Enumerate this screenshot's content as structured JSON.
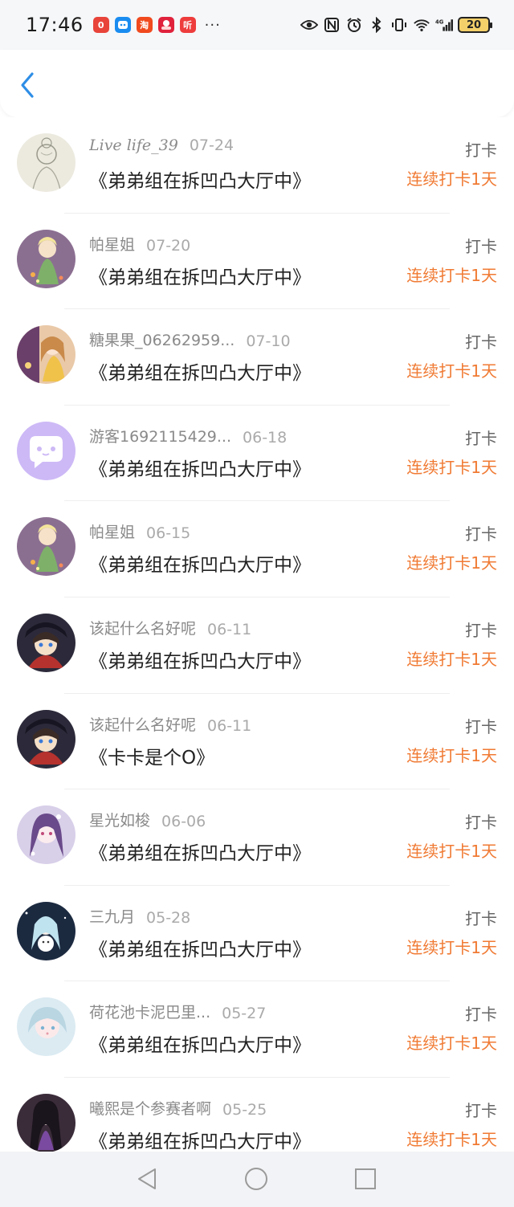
{
  "status_bar": {
    "time": "17:46",
    "app_icons": [
      {
        "icon": "app-red-icon",
        "glyph": "0",
        "color": "#e8443a"
      },
      {
        "icon": "app-blue-icon",
        "glyph": "",
        "color": "#1a8cf0"
      },
      {
        "icon": "taobao-icon",
        "glyph": "淘",
        "color": "#f04a1e"
      },
      {
        "icon": "app-crowd-icon",
        "glyph": "",
        "color": "#e0223c"
      },
      {
        "icon": "listen-icon",
        "glyph": "听",
        "color": "#ee3c3c"
      }
    ],
    "more": "···",
    "battery": "20"
  },
  "header": {
    "back_icon": "chevron-left-icon",
    "accent": "#2e8ee6"
  },
  "records": [
    {
      "name": "Live life_39",
      "date": "07-24",
      "title": "《弟弟组在拆凹凸大厅中》",
      "tag": "打卡",
      "streak": "连续打卡1天",
      "avatar": "sketch"
    },
    {
      "name": "帕星姐",
      "date": "07-20",
      "title": "《弟弟组在拆凹凸大厅中》",
      "tag": "打卡",
      "streak": "连续打卡1天",
      "avatar": "fairy"
    },
    {
      "name": "糖果果_06262959...",
      "date": "07-10",
      "title": "《弟弟组在拆凹凸大厅中》",
      "tag": "打卡",
      "streak": "连续打卡1天",
      "avatar": "girl-gold"
    },
    {
      "name": "游客1692115429...",
      "date": "06-18",
      "title": "《弟弟组在拆凹凸大厅中》",
      "tag": "打卡",
      "streak": "连续打卡1天",
      "avatar": "default"
    },
    {
      "name": "帕星姐",
      "date": "06-15",
      "title": "《弟弟组在拆凹凸大厅中》",
      "tag": "打卡",
      "streak": "连续打卡1天",
      "avatar": "fairy"
    },
    {
      "name": "该起什么名好呢",
      "date": "06-11",
      "title": "《弟弟组在拆凹凸大厅中》",
      "tag": "打卡",
      "streak": "连续打卡1天",
      "avatar": "dark-boy"
    },
    {
      "name": "该起什么名好呢",
      "date": "06-11",
      "title": "《卡卡是个O》",
      "tag": "打卡",
      "streak": "连续打卡1天",
      "avatar": "dark-boy"
    },
    {
      "name": "星光如梭",
      "date": "06-06",
      "title": "《弟弟组在拆凹凸大厅中》",
      "tag": "打卡",
      "streak": "连续打卡1天",
      "avatar": "purple-girl"
    },
    {
      "name": "三九月",
      "date": "05-28",
      "title": "《弟弟组在拆凹凸大厅中》",
      "tag": "打卡",
      "streak": "连续打卡1天",
      "avatar": "night-girl"
    },
    {
      "name": "荷花池卡泥巴里...",
      "date": "05-27",
      "title": "《弟弟组在拆凹凸大厅中》",
      "tag": "打卡",
      "streak": "连续打卡1天",
      "avatar": "pastel-girl"
    },
    {
      "name": "曦熙是个参赛者啊",
      "date": "05-25",
      "title": "《弟弟组在拆凹凸大厅中》",
      "tag": "打卡",
      "streak": "连续打卡1天",
      "avatar": "dark-girl"
    }
  ],
  "colors": {
    "streak": "#f07a33",
    "tag": "#666666",
    "title": "#222222",
    "meta": "#8a8a8a"
  },
  "nav": {
    "back": "triangle-back-icon",
    "home": "circle-home-icon",
    "recents": "square-recents-icon"
  }
}
